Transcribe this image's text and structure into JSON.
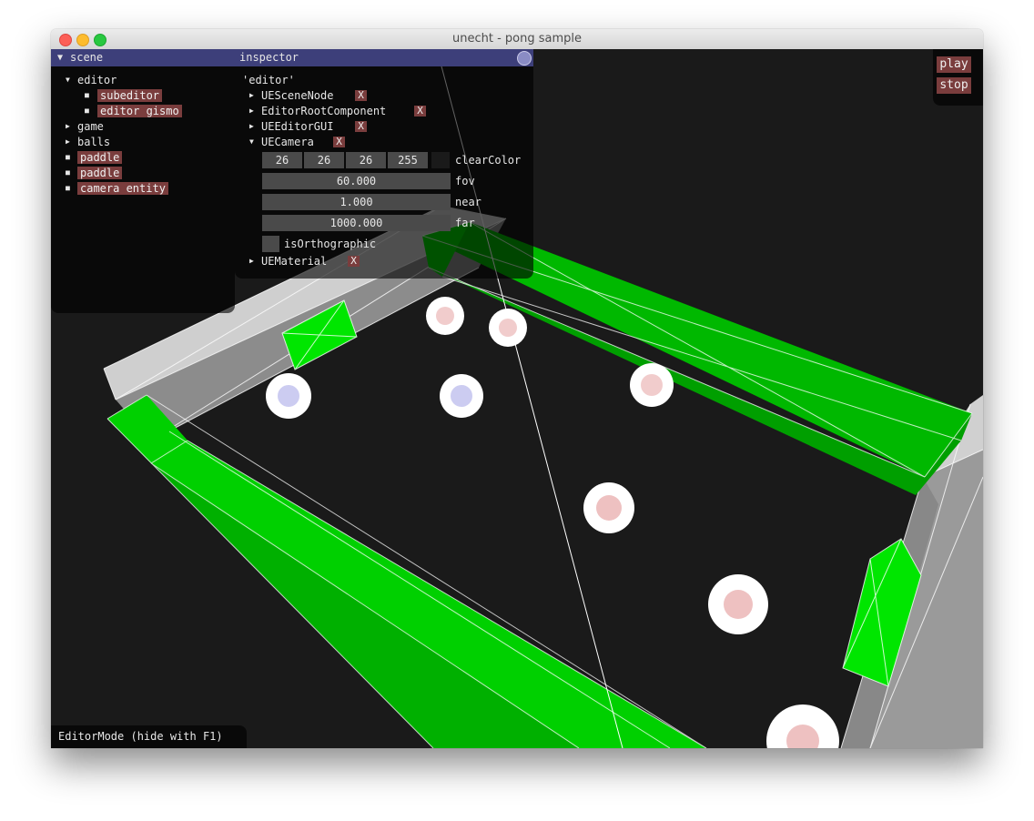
{
  "window": {
    "title": "unecht - pong sample"
  },
  "scene_panel": {
    "title": "scene",
    "items": [
      {
        "label": "editor"
      },
      {
        "label": "subeditor"
      },
      {
        "label": "editor gismo"
      },
      {
        "label": "game"
      },
      {
        "label": "balls"
      },
      {
        "label": "paddle"
      },
      {
        "label": "paddle"
      },
      {
        "label": "camera entity"
      }
    ]
  },
  "inspector": {
    "title": "inspector",
    "entity_name": "'editor'",
    "components": [
      {
        "label": "UESceneNode",
        "remove": "X"
      },
      {
        "label": "EditorRootComponent",
        "remove": "X"
      },
      {
        "label": "UEEditorGUI",
        "remove": "X"
      },
      {
        "label": "UECamera",
        "remove": "X"
      },
      {
        "label": "UEMaterial",
        "remove": "X"
      }
    ],
    "camera": {
      "clear_color": {
        "r": "26",
        "g": "26",
        "b": "26",
        "a": "255",
        "label": "clearColor"
      },
      "fov": {
        "value": "60.000",
        "label": "fov"
      },
      "near": {
        "value": "1.000",
        "label": "near"
      },
      "far": {
        "value": "1000.000",
        "label": "far"
      },
      "orthographic": {
        "label": "isOrthographic",
        "checked": false
      }
    }
  },
  "playback": {
    "play": "play",
    "stop": "stop"
  },
  "status": {
    "text": "EditorMode (hide with F1)"
  },
  "colors": {
    "paddle_green": "#00e600",
    "wall_white": "#d6d6d6",
    "clear": "#1a1a1a",
    "panel_title": "#3d3f7a",
    "tag": "#7a3d3d"
  }
}
